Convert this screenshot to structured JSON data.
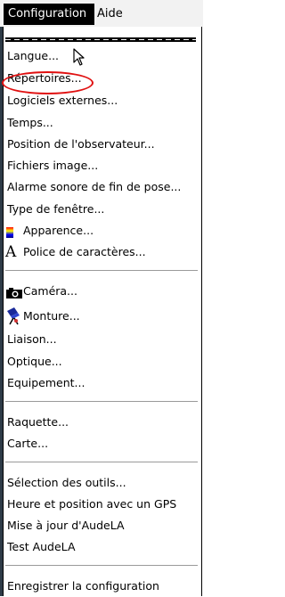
{
  "menubar": {
    "items": [
      {
        "label": "Configuration"
      },
      {
        "label": "Aide"
      }
    ]
  },
  "menu": {
    "items": [
      {
        "label": "Langue..."
      },
      {
        "label": "Répertoires..."
      },
      {
        "label": "Logiciels externes..."
      },
      {
        "label": "Temps..."
      },
      {
        "label": "Position de l'observateur..."
      },
      {
        "label": "Fichiers image..."
      },
      {
        "label": "Alarme sonore de fin de pose..."
      },
      {
        "label": "Type de fenêtre..."
      },
      {
        "label": "Apparence...",
        "icon": "color-palette-icon"
      },
      {
        "label": "Police de caractères...",
        "icon": "font-icon"
      },
      {
        "label": "Caméra...",
        "icon": "camera-icon"
      },
      {
        "label": "Monture...",
        "icon": "telescope-mount-icon"
      },
      {
        "label": "Liaison..."
      },
      {
        "label": "Optique..."
      },
      {
        "label": "Equipement..."
      },
      {
        "label": "Raquette..."
      },
      {
        "label": "Carte..."
      },
      {
        "label": "Sélection des outils..."
      },
      {
        "label": "Heure et position avec un GPS"
      },
      {
        "label": "Mise à jour d'AudeLA"
      },
      {
        "label": "Test AudeLA"
      },
      {
        "label": "Enregistrer la configuration"
      }
    ]
  },
  "colors": {
    "annotation_ring": "#e01010",
    "menubar_active_bg": "#000000"
  }
}
